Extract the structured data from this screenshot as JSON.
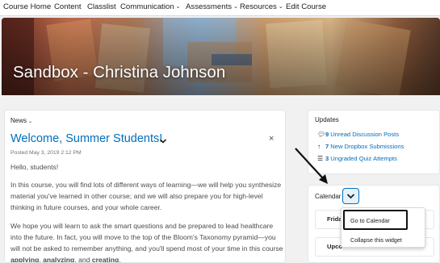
{
  "nav": {
    "items": [
      {
        "label": "Course Home",
        "has_menu": false
      },
      {
        "label": "Content",
        "has_menu": false
      },
      {
        "label": "Classlist",
        "has_menu": false
      },
      {
        "label": "Communication",
        "has_menu": true
      },
      {
        "label": "Assessments",
        "has_menu": true
      },
      {
        "label": "Resources",
        "has_menu": true
      },
      {
        "label": "Edit Course",
        "has_menu": false
      }
    ],
    "chevron": "⌄"
  },
  "banner": {
    "title": "Sandbox - Christina Johnson"
  },
  "news": {
    "header": "News",
    "header_chevron": "⌄",
    "title": "Welcome, Summer Students!",
    "posted": "Posted May 3, 2019 2:12 PM",
    "close_glyph": "×",
    "greeting": "Hello, students!",
    "p1": "In this course, you will find lots of different ways of learning—we will help you synthesize material you've learned in other course; and we will also prepare you for high-level thinking in future courses, and your whole career.",
    "p2_start": "We hope you will learn to ask the smart questions and be prepared to lead healthcare into the future.  In fact, you will move to the top of the Bloom's Taxonomy pyramid—you will not be asked to remember anything, and you'll spend most of your time in this course ",
    "p2_b1": "applying",
    "p2_sep1": ", ",
    "p2_b2": "analyzing",
    "p2_sep2": ", and ",
    "p2_b3": "creating",
    "p2_end": "."
  },
  "updates": {
    "header": "Updates",
    "items": [
      {
        "count": "9",
        "label": "Unread Discussion Posts",
        "icon": "discussion-icon"
      },
      {
        "count": "7",
        "label": "New Dropbox Submissions",
        "icon": "dropbox-icon"
      },
      {
        "count": "3",
        "label": "Ungraded Quiz Attempts",
        "icon": "quiz-icon"
      }
    ]
  },
  "calendar": {
    "header": "Calendar",
    "rows": [
      "Friday",
      "Upcoming"
    ],
    "rows_visible": [
      "Frida",
      "Upco"
    ],
    "menu": {
      "items": [
        "Go to Calendar",
        "Collapse this widget"
      ]
    }
  },
  "colors": {
    "link": "#006fbf",
    "text": "#494c4e",
    "background": "#f1f1f1"
  }
}
